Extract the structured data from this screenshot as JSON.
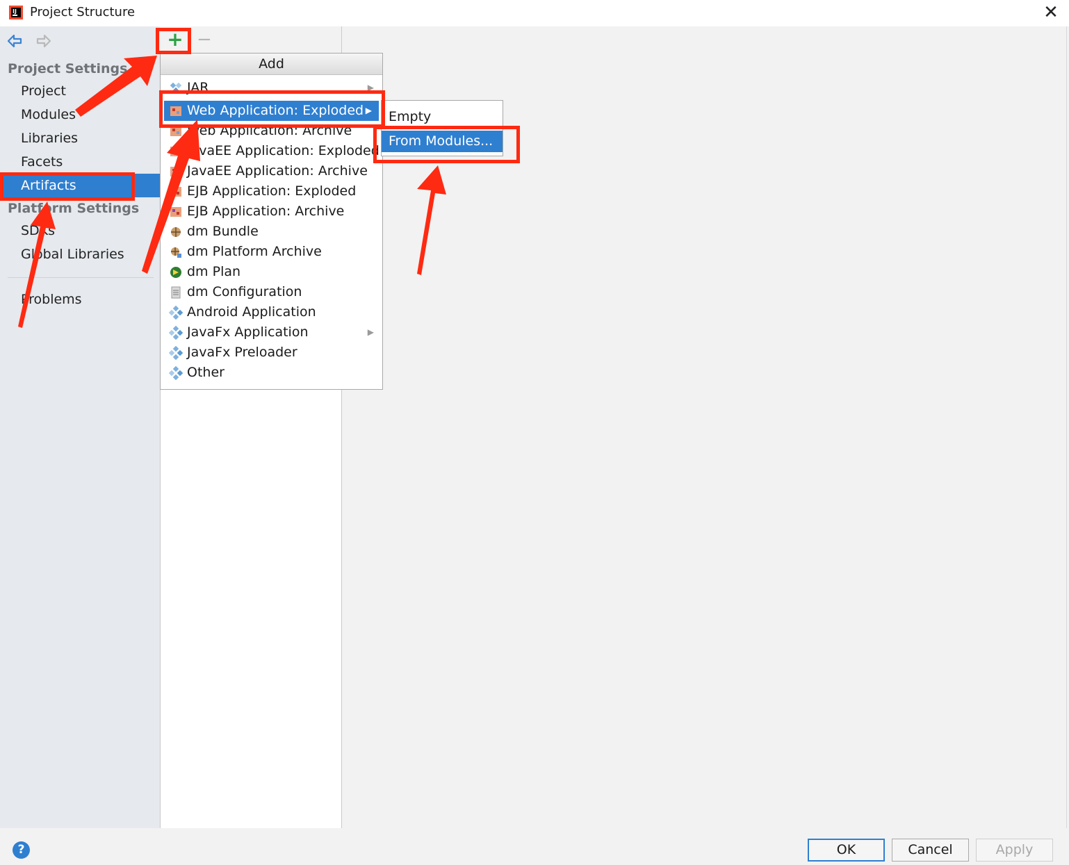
{
  "window": {
    "title": "Project Structure",
    "close_icon": "close-icon"
  },
  "sidebar": {
    "project_settings_header": "Project Settings",
    "items_project": [
      {
        "label": "Project"
      },
      {
        "label": "Modules"
      },
      {
        "label": "Libraries"
      },
      {
        "label": "Facets"
      },
      {
        "label": "Artifacts",
        "selected": true
      }
    ],
    "platform_settings_header": "Platform Settings",
    "items_platform": [
      {
        "label": "SDKs"
      },
      {
        "label": "Global Libraries"
      }
    ],
    "problems_label": "Problems"
  },
  "toolbar": {
    "add_symbol": "+",
    "remove_symbol": "−"
  },
  "add_menu": {
    "title": "Add",
    "items": [
      {
        "label": "JAR",
        "icon": "jar-icon",
        "submenu": true
      },
      {
        "label": "Web Application: Exploded",
        "icon": "web-app-icon",
        "submenu": true,
        "selected": true
      },
      {
        "label": "Web Application: Archive",
        "icon": "web-app-icon"
      },
      {
        "label": "JavaEE Application: Exploded",
        "icon": "javaee-icon"
      },
      {
        "label": "JavaEE Application: Archive",
        "icon": "javaee-icon"
      },
      {
        "label": "EJB Application: Exploded",
        "icon": "ejb-icon"
      },
      {
        "label": "EJB Application: Archive",
        "icon": "ejb-icon"
      },
      {
        "label": "dm Bundle",
        "icon": "dm-bundle-icon"
      },
      {
        "label": "dm Platform Archive",
        "icon": "dm-platform-icon"
      },
      {
        "label": "dm Plan",
        "icon": "dm-plan-icon"
      },
      {
        "label": "dm Configuration",
        "icon": "dm-config-icon"
      },
      {
        "label": "Android Application",
        "icon": "artifact-icon"
      },
      {
        "label": "JavaFx Application",
        "icon": "artifact-icon",
        "submenu": true
      },
      {
        "label": "JavaFx Preloader",
        "icon": "artifact-icon"
      },
      {
        "label": "Other",
        "icon": "artifact-icon"
      }
    ]
  },
  "submenu": {
    "items": [
      {
        "label": "Empty"
      },
      {
        "label": "From Modules...",
        "selected": true
      }
    ]
  },
  "footer": {
    "help": "?",
    "ok": "OK",
    "cancel": "Cancel",
    "apply": "Apply"
  },
  "colors": {
    "selection": "#2f7fd0",
    "annotation_red": "#ff2a12",
    "add_green": "#2ea043"
  }
}
